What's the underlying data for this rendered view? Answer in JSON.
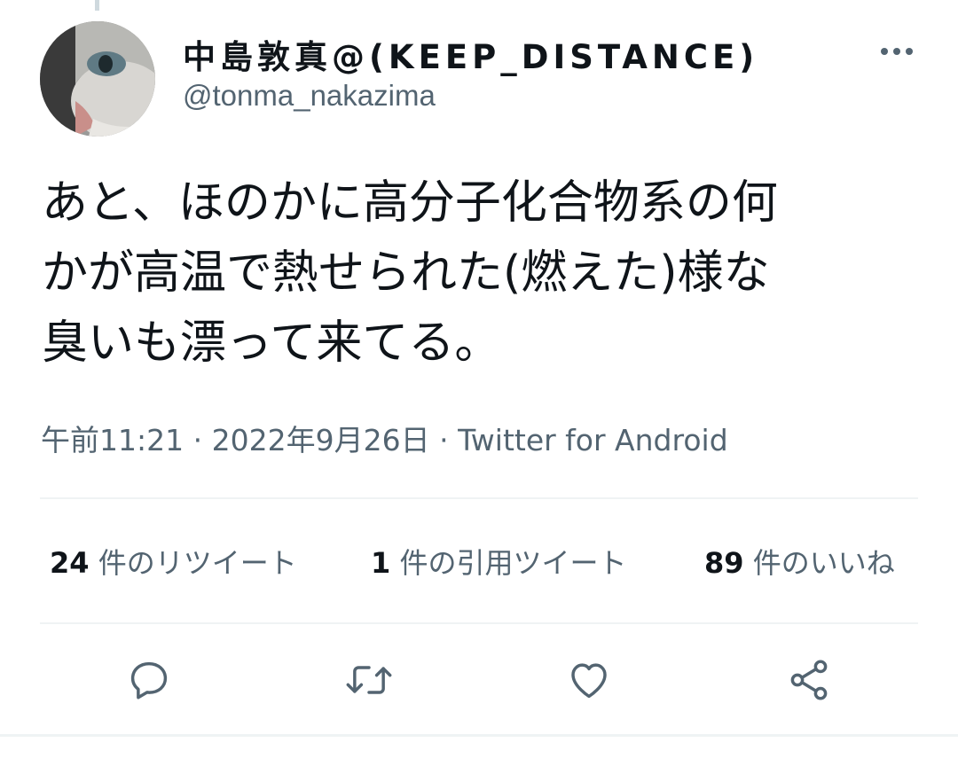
{
  "author": {
    "display_name": "中島敦真@(KEEP_DISTANCE)",
    "handle": "@tonma_nakazima",
    "avatar_icon": "cat-photo-avatar"
  },
  "tweet": {
    "lines": [
      "あと、ほのかに高分子化合物系の何",
      "かが高温で熱せられた(燃えた)様な",
      "臭いも漂って来てる。"
    ],
    "time": "午前11:21",
    "separator": "·",
    "date": "2022年9月26日",
    "source": "Twitter for Android"
  },
  "stats": {
    "retweets": {
      "count": "24",
      "label": "件のリツイート"
    },
    "quotes": {
      "count": "1",
      "label": "件の引用ツイート"
    },
    "likes": {
      "count": "89",
      "label": "件のいいね"
    }
  },
  "actions": [
    {
      "icon": "reply-icon"
    },
    {
      "icon": "retweet-icon"
    },
    {
      "icon": "like-icon"
    },
    {
      "icon": "share-icon"
    }
  ],
  "colors": {
    "text_primary": "#0f1419",
    "text_secondary": "#536471",
    "divider": "#eff3f4"
  }
}
